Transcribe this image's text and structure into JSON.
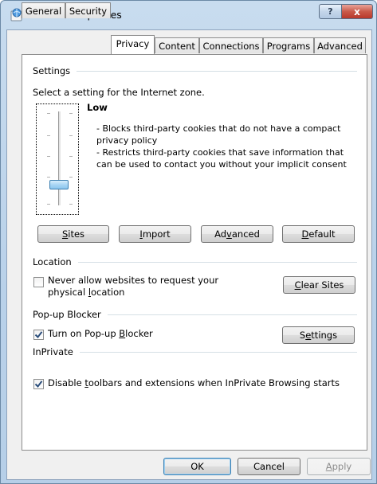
{
  "window": {
    "title": "Internet Properties",
    "help_label": "?",
    "close_label": "x"
  },
  "tabs": [
    {
      "label": "General"
    },
    {
      "label": "Security"
    },
    {
      "label": "Privacy"
    },
    {
      "label": "Content"
    },
    {
      "label": "Connections"
    },
    {
      "label": "Programs"
    },
    {
      "label": "Advanced"
    }
  ],
  "active_tab": "Privacy",
  "settings": {
    "heading": "Settings",
    "instruction": "Select a setting for the Internet zone.",
    "level_name": "Low",
    "description_lines": [
      "- Blocks third-party cookies that do not have a compact",
      "privacy policy",
      "- Restricts third-party cookies that save information that",
      "can be used to contact you without your implicit consent"
    ],
    "slider_level": "Low",
    "buttons": {
      "sites": {
        "pre": "",
        "accel": "S",
        "post": "ites"
      },
      "import": {
        "pre": "",
        "accel": "I",
        "post": "mport"
      },
      "advanced": {
        "pre": "Ad",
        "accel": "v",
        "post": "anced"
      },
      "default": {
        "pre": "",
        "accel": "D",
        "post": "efault"
      }
    }
  },
  "location": {
    "heading": "Location",
    "never_allow": {
      "line1": "Never allow websites to request your",
      "line2_pre": "physical ",
      "line2_accel": "l",
      "line2_post": "ocation",
      "checked": false
    },
    "clear_sites": {
      "pre": "",
      "accel": "C",
      "post": "lear Sites"
    }
  },
  "popup": {
    "heading": "Pop-up Blocker",
    "turn_on": {
      "pre": "Turn on Pop-up ",
      "accel": "B",
      "post": "locker",
      "checked": true
    },
    "settings": {
      "pre": "S",
      "accel": "e",
      "post": "ttings"
    }
  },
  "inprivate": {
    "heading": "InPrivate",
    "disable": {
      "pre": "Disable ",
      "accel": "t",
      "post": "oolbars and extensions when InPrivate Browsing starts",
      "checked": true
    }
  },
  "footer": {
    "ok": "OK",
    "cancel": "Cancel",
    "apply": {
      "pre": "",
      "accel": "A",
      "post": "pply"
    }
  },
  "colors": {
    "frame": "#b9d1e9",
    "close": "#c95a4a",
    "accent": "#3c7fb1"
  },
  "icons": {
    "window": "internet-globe-icon",
    "help": "help-icon",
    "close": "close-icon",
    "check": "checkmark-icon"
  }
}
